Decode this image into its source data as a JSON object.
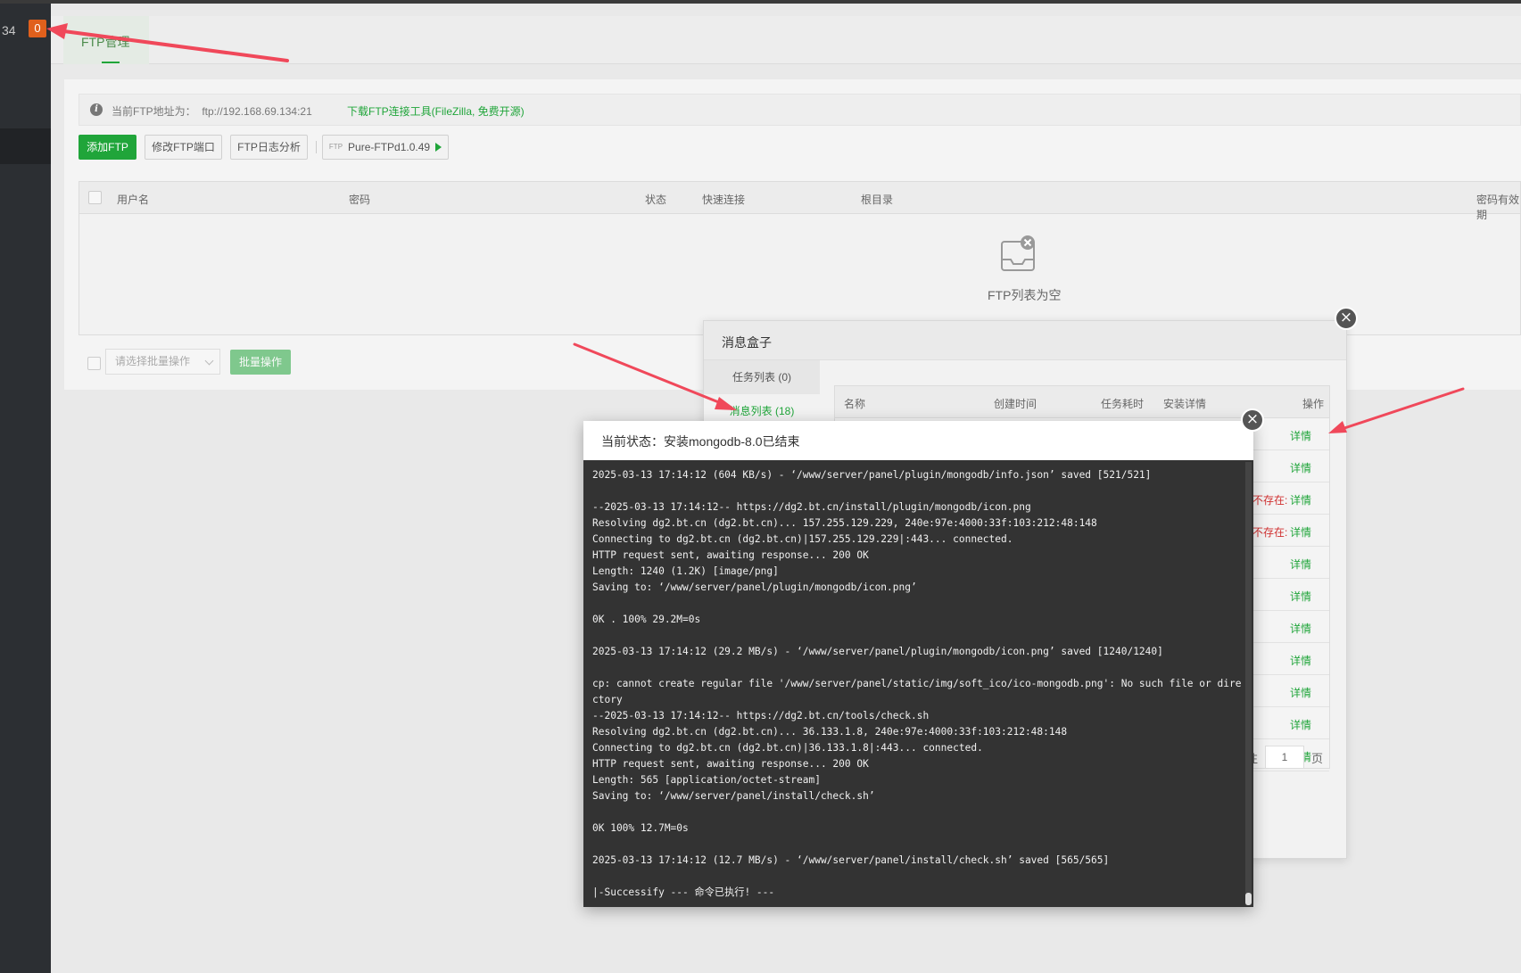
{
  "sidebar": {
    "number": "34",
    "badge": "0"
  },
  "tabs": [
    {
      "label": "FTP管理"
    }
  ],
  "info": {
    "address_label": "当前FTP地址为：",
    "address": "ftp://192.168.69.134:21",
    "download_link": "下载FTP连接工具(FileZilla, 免费开源)"
  },
  "toolbar": {
    "add": "添加FTP",
    "port": "修改FTP端口",
    "log": "FTP日志分析",
    "pure_tag": "FTP",
    "pure": "Pure-FTPd1.0.49"
  },
  "table": {
    "headers": [
      "用户名",
      "密码",
      "状态",
      "快速连接",
      "根目录",
      "密码有效期"
    ],
    "empty_text": "FTP列表为空"
  },
  "batch": {
    "select_placeholder": "请选择批量操作",
    "button": "批量操作"
  },
  "msgbox": {
    "title": "消息盒子",
    "close": "×",
    "tabs": [
      "任务列表 (0)",
      "消息列表 (18)"
    ],
    "headers": [
      "名称",
      "创建时间",
      "任务耗时",
      "安装详情",
      "操作"
    ],
    "rows": [
      {
        "detail": "详情",
        "note": ""
      },
      {
        "detail": "详情",
        "note": ""
      },
      {
        "detail": "详情",
        "note": "不存在:"
      },
      {
        "detail": "详情",
        "note": "不存在:"
      },
      {
        "detail": "详情",
        "note": ""
      },
      {
        "detail": "详情",
        "note": ""
      },
      {
        "detail": "详情",
        "note": ""
      },
      {
        "detail": "详情",
        "note": ""
      },
      {
        "detail": "详情",
        "note": ""
      },
      {
        "detail": "详情",
        "note": ""
      },
      {
        "detail": "详情",
        "note": ""
      }
    ],
    "pager": {
      "prefix": "往",
      "page": "1",
      "suffix": "页"
    }
  },
  "dialog": {
    "title": "当前状态：安装mongodb-8.0已结束",
    "close": "×",
    "log": [
      "2025-03-13 17:14:12 (604 KB/s) - ‘/www/server/panel/plugin/mongodb/info.json’ saved [521/521]",
      "",
      "--2025-03-13 17:14:12-- https://dg2.bt.cn/install/plugin/mongodb/icon.png",
      "Resolving dg2.bt.cn (dg2.bt.cn)... 157.255.129.229, 240e:97e:4000:33f:103:212:48:148",
      "Connecting to dg2.bt.cn (dg2.bt.cn)|157.255.129.229|:443... connected.",
      "HTTP request sent, awaiting response... 200 OK",
      "Length: 1240 (1.2K) [image/png]",
      "Saving to: ‘/www/server/panel/plugin/mongodb/icon.png’",
      "",
      "0K . 100% 29.2M=0s",
      "",
      "2025-03-13 17:14:12 (29.2 MB/s) - ‘/www/server/panel/plugin/mongodb/icon.png’ saved [1240/1240]",
      "",
      "cp: cannot create regular file '/www/server/panel/static/img/soft_ico/ico-mongodb.png': No such file or directory",
      "--2025-03-13 17:14:12-- https://dg2.bt.cn/tools/check.sh",
      "Resolving dg2.bt.cn (dg2.bt.cn)... 36.133.1.8, 240e:97e:4000:33f:103:212:48:148",
      "Connecting to dg2.bt.cn (dg2.bt.cn)|36.133.1.8|:443... connected.",
      "HTTP request sent, awaiting response... 200 OK",
      "Length: 565 [application/octet-stream]",
      "Saving to: ‘/www/server/panel/install/check.sh’",
      "",
      "0K 100% 12.7M=0s",
      "",
      "2025-03-13 17:14:12 (12.7 MB/s) - ‘/www/server/panel/install/check.sh’ saved [565/565]",
      "",
      "|-Successify --- 命令已执行! ---"
    ]
  },
  "colors": {
    "accent": "#20a53a",
    "badge": "#e0601c",
    "arrow": "#f0485a",
    "error": "#d03030"
  }
}
